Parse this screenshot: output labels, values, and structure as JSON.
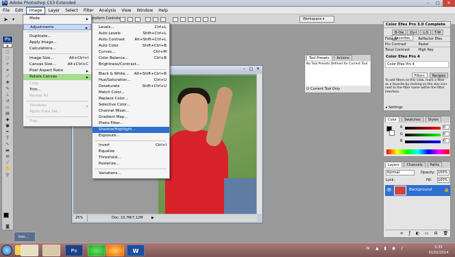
{
  "app": {
    "title": "Adobe Photoshop CS3 Extended"
  },
  "window_buttons": {
    "minimize": "–",
    "maximize": "□",
    "close": "✕"
  },
  "menubar": [
    "File",
    "Edit",
    "Image",
    "Layer",
    "Select",
    "Filter",
    "Analysis",
    "View",
    "Window",
    "Help"
  ],
  "options_bar": {
    "transform_controls": "Transform Controls",
    "workspace": "Workspace ▾"
  },
  "image_menu": [
    {
      "label": "Mode",
      "sub": true
    },
    {
      "label": "Adjustments",
      "sub": true,
      "highlight": true
    },
    {
      "label": "Duplicate..."
    },
    {
      "label": "Apply Image..."
    },
    {
      "label": "Calculations..."
    },
    {
      "label": "Image Size...",
      "shortcut": "Alt+Ctrl+I"
    },
    {
      "label": "Canvas Size...",
      "shortcut": "Alt+Ctrl+C"
    },
    {
      "label": "Pixel Aspect Ratio",
      "sub": true
    },
    {
      "label": "Rotate Canvas",
      "sub": true,
      "green": true
    },
    {
      "label": "Crop",
      "disabled": true
    },
    {
      "label": "Trim..."
    },
    {
      "label": "Reveal All",
      "disabled": true
    },
    {
      "label": "Variables",
      "sub": true,
      "disabled": true
    },
    {
      "label": "Apply Data Set...",
      "disabled": true
    },
    {
      "label": "Trap...",
      "disabled": true
    }
  ],
  "adjustments_menu": [
    {
      "label": "Levels...",
      "shortcut": "Ctrl+L"
    },
    {
      "label": "Auto Levels",
      "shortcut": "Shift+Ctrl+L"
    },
    {
      "label": "Auto Contrast",
      "shortcut": "Alt+Shift+Ctrl+L"
    },
    {
      "label": "Auto Color",
      "shortcut": "Shift+Ctrl+B"
    },
    {
      "label": "Curves...",
      "shortcut": "Ctrl+M"
    },
    {
      "label": "Color Balance...",
      "shortcut": "Ctrl+B"
    },
    {
      "label": "Brightness/Contrast..."
    },
    {
      "label": "Black & White...",
      "shortcut": "Alt+Shift+Ctrl+B"
    },
    {
      "label": "Hue/Saturation...",
      "shortcut": "Ctrl+U"
    },
    {
      "label": "Desaturate",
      "shortcut": "Shift+Ctrl+U"
    },
    {
      "label": "Match Color..."
    },
    {
      "label": "Replace Color..."
    },
    {
      "label": "Selective Color..."
    },
    {
      "label": "Channel Mixer..."
    },
    {
      "label": "Gradient Map..."
    },
    {
      "label": "Photo Filter..."
    },
    {
      "label": "Shadow/Highlight...",
      "highlight": true
    },
    {
      "label": "Exposure..."
    },
    {
      "label": "Invert",
      "shortcut": "Ctrl+I"
    },
    {
      "label": "Equalize"
    },
    {
      "label": "Threshold..."
    },
    {
      "label": "Posterize..."
    },
    {
      "label": "Variations..."
    }
  ],
  "document": {
    "zoom": "25%",
    "doc_info": "Doc: 10,7M/7,12M"
  },
  "tool_presets": {
    "tab1": "Tool Presets",
    "tab2": "Actions",
    "message": "No Tool Presets Defined for Current Tool.",
    "current_only": "Current Tool Only"
  },
  "color_efex": {
    "title": "Color Efex Pro 3.0 Complete",
    "tabs": [
      "B-Ow",
      "Dy-I",
      "L-S",
      "T-W",
      "Favorites"
    ],
    "rows": [
      [
        "Foliage",
        "Reflector Efex"
      ],
      [
        "Pro Contrast",
        "Pastel"
      ],
      [
        "Tonal Contrast",
        "High Key"
      ]
    ],
    "sub": "Color Efex Pro 4",
    "item": "Color Efex Pro 4",
    "btn_filters": "Filters",
    "btn_recipes": "Recipes",
    "help": "To add filters to this view, mark a filter as a favorite by clicking on the star icon next to the filter name within the filter interface.",
    "settings": "Settings"
  },
  "color_panel": {
    "tabs": [
      "Color",
      "Swatches",
      "Styles"
    ],
    "r": "R",
    "g": "G",
    "b": "B",
    "r_val": "0",
    "g_val": "0",
    "b_val": "0"
  },
  "layers_panel": {
    "tabs": [
      "Layers",
      "Channels",
      "Paths"
    ],
    "mode": "Normal",
    "opacity_label": "Opacity:",
    "opacity": "100%",
    "lock_label": "Lock:",
    "fill_label": "Fill:",
    "fill": "100%",
    "layer_name": "Background"
  },
  "taskbar": {
    "doc_btn": "tion...",
    "lang": "IN",
    "time": "5:33",
    "date": "01/02/2014"
  },
  "colors": {
    "accent": "#2f6fd0",
    "close": "#c8463e",
    "taskbar": "#8a5f5d"
  }
}
